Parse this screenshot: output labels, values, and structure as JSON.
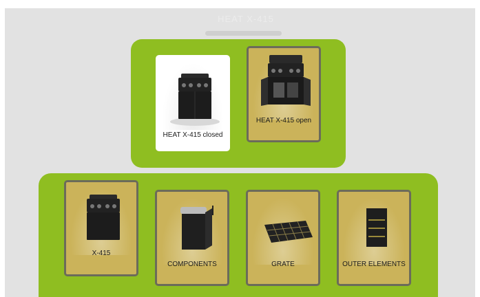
{
  "header": {
    "title": "HEAT X-415"
  },
  "variants": [
    {
      "label": "HEAT X-415 closed",
      "selected": true,
      "icon": "grill-closed-icon"
    },
    {
      "label": "HEAT X-415 open",
      "selected": false,
      "icon": "grill-open-icon"
    }
  ],
  "categories": [
    {
      "label": "X-415",
      "icon": "grill-closed-icon"
    },
    {
      "label": "COMPONENTS",
      "icon": "grill-components-icon"
    },
    {
      "label": "GRATE",
      "icon": "grate-icon"
    },
    {
      "label": "OUTER ELEMENTS",
      "icon": "outer-elements-icon"
    }
  ],
  "colors": {
    "group_green": "#8fbe21",
    "tile_gold": "#cbb35a",
    "tile_border": "#6b6b5a",
    "panel_gray": "#e2e2e2"
  }
}
